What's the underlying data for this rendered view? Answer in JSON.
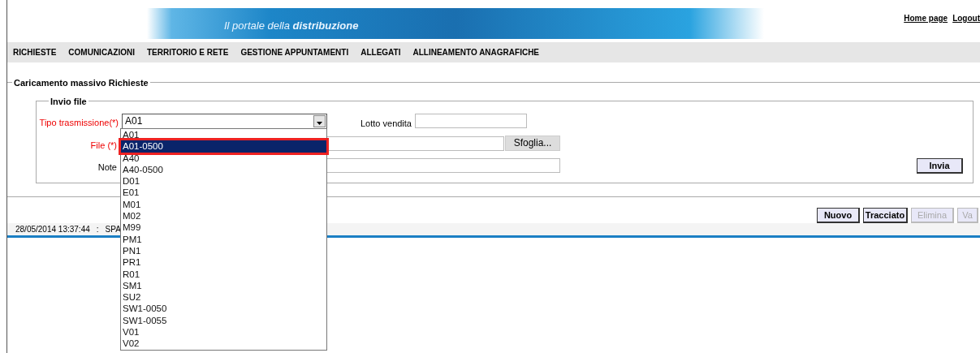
{
  "banner": {
    "tagline": "Il portale della **distribuzione**"
  },
  "top_links": [
    {
      "label": "Home page"
    },
    {
      "label": "Logout"
    }
  ],
  "menu": [
    {
      "label": "RICHIESTE"
    },
    {
      "label": "COMUNICAZIONI"
    },
    {
      "label": "TERRITORIO E RETE"
    },
    {
      "label": "GESTIONE APPUNTAMENTI"
    },
    {
      "label": "ALLEGATI"
    },
    {
      "label": "ALLINEAMENTO ANAGRAFICHE"
    }
  ],
  "section": {
    "title": "Caricamento massivo Richieste",
    "subsection": "Invio file",
    "fields": {
      "tipo_trasmissione": {
        "label": "Tipo trasmissione(*)",
        "value": "A01",
        "expanded": true,
        "options": [
          {
            "label": "A01",
            "highlighted": false
          },
          {
            "label": "A01-0500",
            "highlighted": true
          },
          {
            "label": "A40",
            "highlighted": false
          },
          {
            "label": "A40-0500",
            "highlighted": false
          },
          {
            "label": "D01",
            "highlighted": false
          },
          {
            "label": "E01",
            "highlighted": false
          },
          {
            "label": "M01",
            "highlighted": false
          },
          {
            "label": "M02",
            "highlighted": false
          },
          {
            "label": "M99",
            "highlighted": false
          },
          {
            "label": "PM1",
            "highlighted": false
          },
          {
            "label": "PN1",
            "highlighted": false
          },
          {
            "label": "PR1",
            "highlighted": false
          },
          {
            "label": "R01",
            "highlighted": false
          },
          {
            "label": "SM1",
            "highlighted": false
          },
          {
            "label": "SU2",
            "highlighted": false
          },
          {
            "label": "SW1-0050",
            "highlighted": false
          },
          {
            "label": "SW1-0055",
            "highlighted": false
          },
          {
            "label": "V01",
            "highlighted": false
          },
          {
            "label": "V02",
            "highlighted": false
          }
        ]
      },
      "lotto_vendita": {
        "label": "Lotto vendita"
      },
      "file": {
        "label": "File (*)",
        "browse": "Sfoglia..."
      },
      "note": {
        "label": "Note"
      }
    },
    "submit": "Invia"
  },
  "actions": [
    {
      "label": "Nuovo",
      "disabled": false
    },
    {
      "label": "Tracciato",
      "disabled": false
    },
    {
      "label": "Elimina",
      "disabled": true
    },
    {
      "label": "Va",
      "disabled": true
    }
  ],
  "status_bar": {
    "timestamp": "28/05/2014 13:37:44",
    "separator": ":",
    "user": "SPA"
  }
}
